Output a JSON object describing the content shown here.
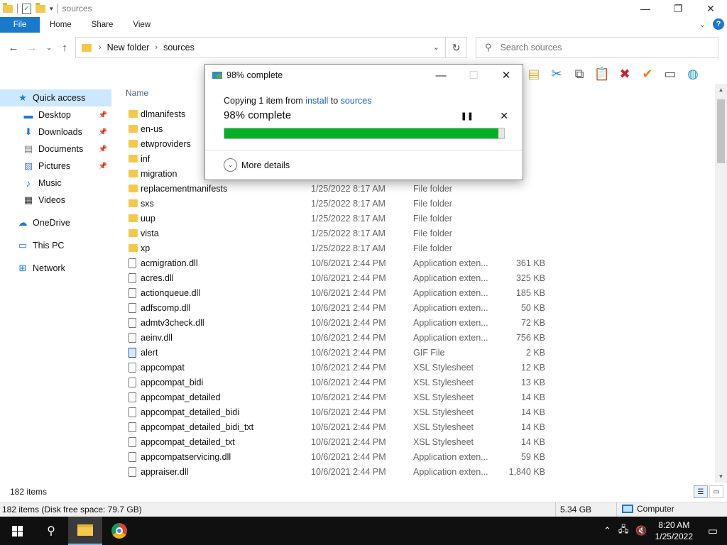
{
  "window": {
    "title": "sources",
    "controls": {
      "minimize": "—",
      "maximize": "❐",
      "close": "✕"
    }
  },
  "ribbon": {
    "tabs": [
      "File",
      "Home",
      "Share",
      "View"
    ],
    "expand": "⌄",
    "help": "?"
  },
  "address": {
    "crumbs": [
      "New folder",
      "sources"
    ],
    "search_placeholder": "Search sources"
  },
  "nav": {
    "quick_access": "Quick access",
    "items": [
      {
        "label": "Desktop",
        "pinned": true
      },
      {
        "label": "Downloads",
        "pinned": true
      },
      {
        "label": "Documents",
        "pinned": true
      },
      {
        "label": "Pictures",
        "pinned": true
      },
      {
        "label": "Music",
        "pinned": false
      },
      {
        "label": "Videos",
        "pinned": false
      }
    ],
    "onedrive": "OneDrive",
    "thispc": "This PC",
    "network": "Network"
  },
  "list": {
    "column_name": "Name",
    "rows": [
      {
        "name": "dlmanifests",
        "date": "",
        "type": "",
        "size": "",
        "kind": "folder"
      },
      {
        "name": "en-us",
        "date": "",
        "type": "",
        "size": "",
        "kind": "folder"
      },
      {
        "name": "etwproviders",
        "date": "",
        "type": "",
        "size": "",
        "kind": "folder"
      },
      {
        "name": "inf",
        "date": "",
        "type": "",
        "size": "",
        "kind": "folder"
      },
      {
        "name": "migration",
        "date": "",
        "type": "",
        "size": "",
        "kind": "folder"
      },
      {
        "name": "replacementmanifests",
        "date": "1/25/2022 8:17 AM",
        "type": "File folder",
        "size": "",
        "kind": "folder"
      },
      {
        "name": "sxs",
        "date": "1/25/2022 8:17 AM",
        "type": "File folder",
        "size": "",
        "kind": "folder"
      },
      {
        "name": "uup",
        "date": "1/25/2022 8:17 AM",
        "type": "File folder",
        "size": "",
        "kind": "folder"
      },
      {
        "name": "vista",
        "date": "1/25/2022 8:17 AM",
        "type": "File folder",
        "size": "",
        "kind": "folder"
      },
      {
        "name": "xp",
        "date": "1/25/2022 8:17 AM",
        "type": "File folder",
        "size": "",
        "kind": "folder"
      },
      {
        "name": "acmigration.dll",
        "date": "10/6/2021 2:44 PM",
        "type": "Application exten...",
        "size": "361 KB",
        "kind": "file"
      },
      {
        "name": "acres.dll",
        "date": "10/6/2021 2:44 PM",
        "type": "Application exten...",
        "size": "325 KB",
        "kind": "file"
      },
      {
        "name": "actionqueue.dll",
        "date": "10/6/2021 2:44 PM",
        "type": "Application exten...",
        "size": "185 KB",
        "kind": "file"
      },
      {
        "name": "adfscomp.dll",
        "date": "10/6/2021 2:44 PM",
        "type": "Application exten...",
        "size": "50 KB",
        "kind": "file"
      },
      {
        "name": "admtv3check.dll",
        "date": "10/6/2021 2:44 PM",
        "type": "Application exten...",
        "size": "72 KB",
        "kind": "file"
      },
      {
        "name": "aeinv.dll",
        "date": "10/6/2021 2:44 PM",
        "type": "Application exten...",
        "size": "756 KB",
        "kind": "file"
      },
      {
        "name": "alert",
        "date": "10/6/2021 2:44 PM",
        "type": "GIF File",
        "size": "2 KB",
        "kind": "gif"
      },
      {
        "name": "appcompat",
        "date": "10/6/2021 2:44 PM",
        "type": "XSL Stylesheet",
        "size": "12 KB",
        "kind": "file"
      },
      {
        "name": "appcompat_bidi",
        "date": "10/6/2021 2:44 PM",
        "type": "XSL Stylesheet",
        "size": "13 KB",
        "kind": "file"
      },
      {
        "name": "appcompat_detailed",
        "date": "10/6/2021 2:44 PM",
        "type": "XSL Stylesheet",
        "size": "14 KB",
        "kind": "file"
      },
      {
        "name": "appcompat_detailed_bidi",
        "date": "10/6/2021 2:44 PM",
        "type": "XSL Stylesheet",
        "size": "14 KB",
        "kind": "file"
      },
      {
        "name": "appcompat_detailed_bidi_txt",
        "date": "10/6/2021 2:44 PM",
        "type": "XSL Stylesheet",
        "size": "14 KB",
        "kind": "file"
      },
      {
        "name": "appcompat_detailed_txt",
        "date": "10/6/2021 2:44 PM",
        "type": "XSL Stylesheet",
        "size": "14 KB",
        "kind": "file"
      },
      {
        "name": "appcompatservicing.dll",
        "date": "10/6/2021 2:44 PM",
        "type": "Application exten...",
        "size": "59 KB",
        "kind": "file"
      },
      {
        "name": "appraiser.dll",
        "date": "10/6/2021 2:44 PM",
        "type": "Application exten...",
        "size": "1,840 KB",
        "kind": "file"
      }
    ],
    "item_count": "182 items"
  },
  "status": {
    "left": "182 items (Disk free space: 79.7 GB)",
    "size": "5.34 GB",
    "location": "Computer"
  },
  "dialog": {
    "title": "98% complete",
    "copy_prefix": "Copying 1 item from ",
    "source": "install",
    "to_word": " to ",
    "destination": "sources",
    "percent_text": "98% complete",
    "progress": 0.98,
    "pause": "❚❚",
    "cancel": "✕",
    "more_details": "More details"
  },
  "taskbar": {
    "time": "8:20 AM",
    "date": "1/25/2022"
  },
  "colors": {
    "accent": "#1979ca",
    "progress": "#06b025",
    "link": "#1a62b8"
  }
}
